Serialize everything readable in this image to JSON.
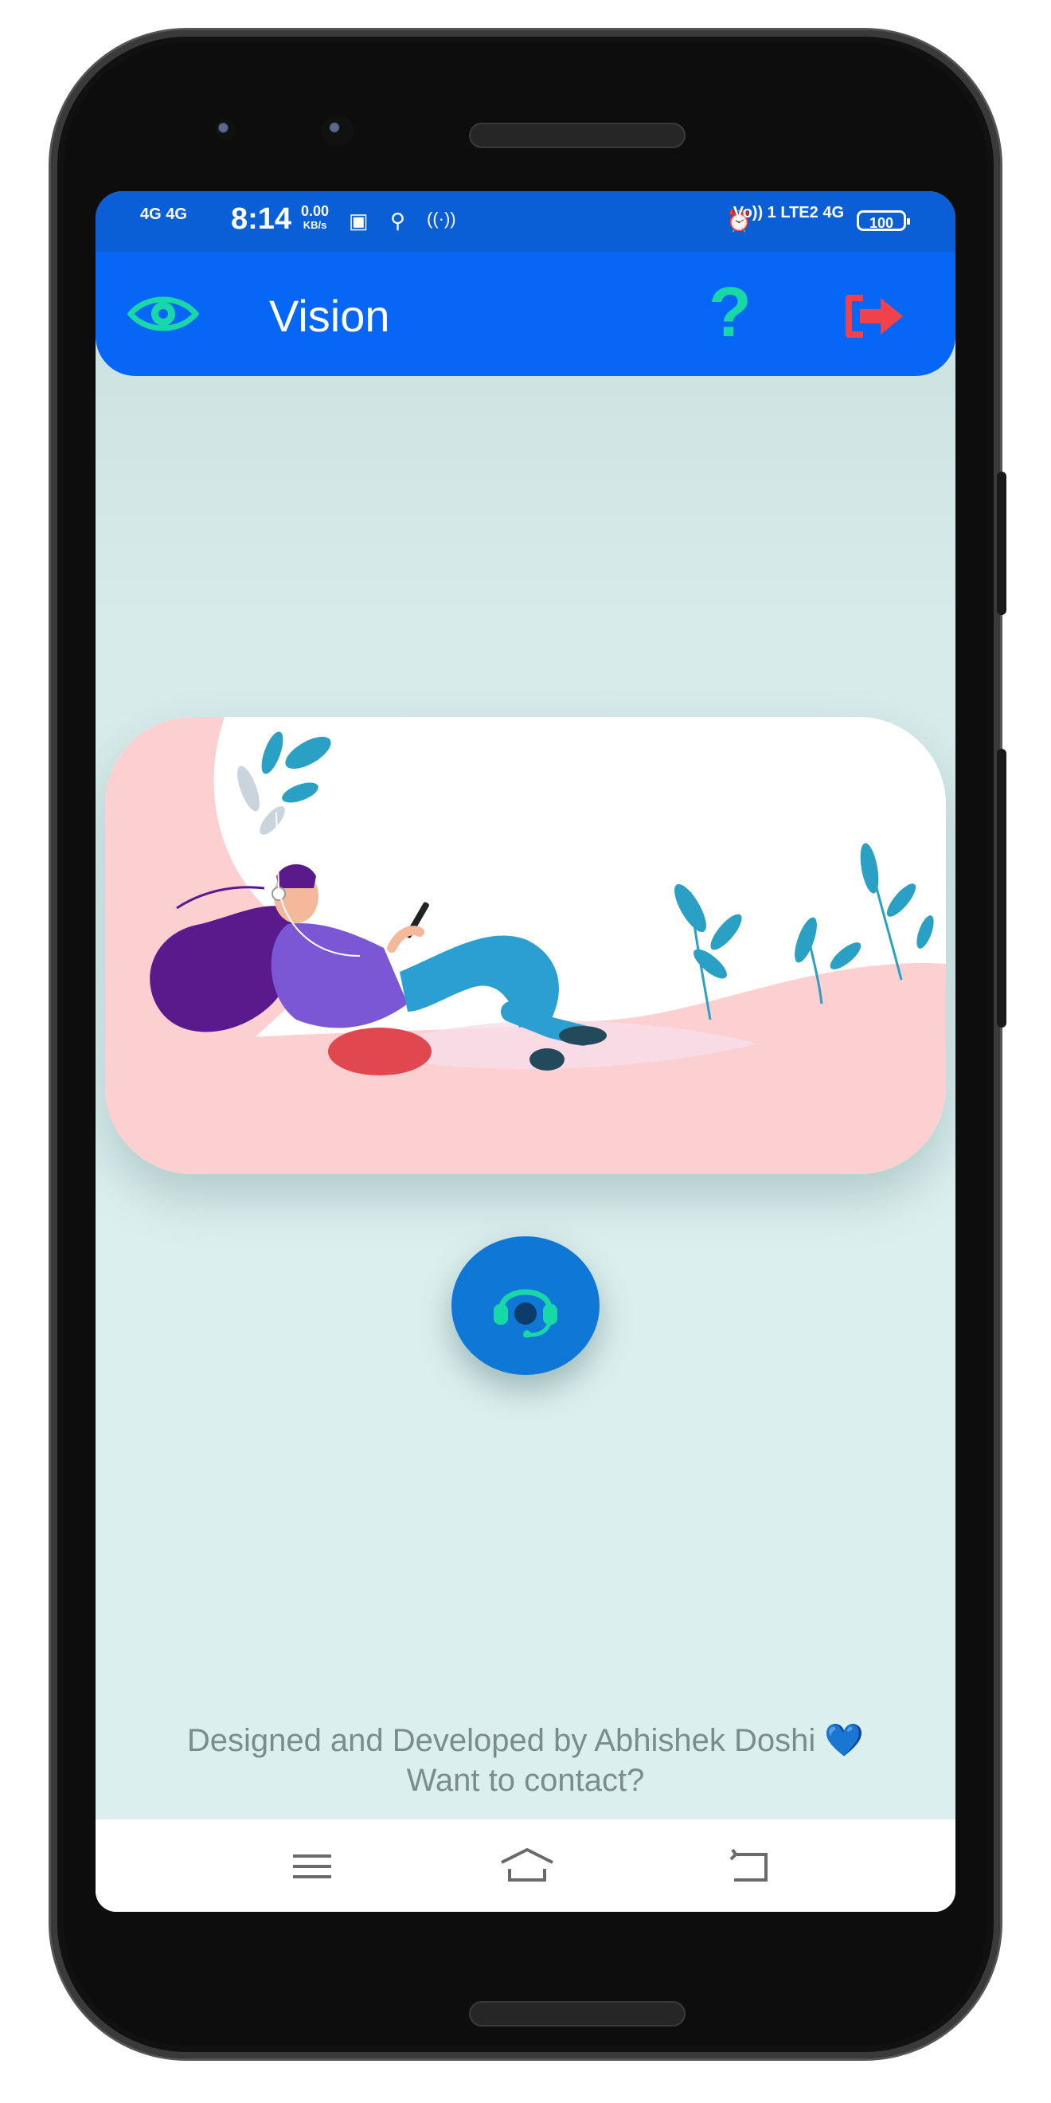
{
  "status_bar": {
    "network_left": "4G 4G",
    "time": "8:14",
    "speed_value": "0.00",
    "speed_unit": "KB/s",
    "network_right": "Vo)) 1 LTE2 4G",
    "battery": "100"
  },
  "app_bar": {
    "title": "Vision",
    "eye_icon": "eye-icon",
    "help_icon": "question-icon",
    "logout_icon": "logout-icon",
    "help_glyph": "?"
  },
  "colors": {
    "status_bar": "#0a5ed6",
    "app_bar": "#0866f7",
    "accent_green": "#19d8a8",
    "logout_red": "#f0424a",
    "fab": "#0f77d6"
  },
  "illustration": "woman-lying-with-phone-illustration",
  "fab": {
    "icon": "headset-support-icon"
  },
  "footer": {
    "credit": "Designed and Developed by Abhishek Doshi",
    "heart": "💙",
    "contact": "Want to contact?"
  },
  "nav_bar": {
    "items": [
      "menu-icon",
      "home-icon",
      "back-icon"
    ]
  }
}
